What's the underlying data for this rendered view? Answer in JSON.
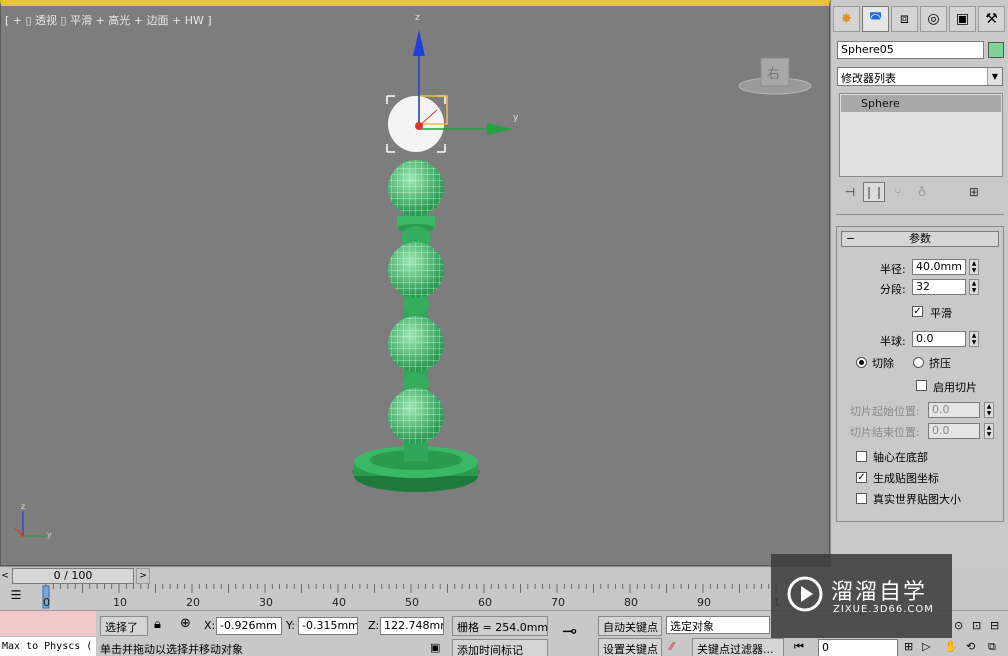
{
  "viewport": {
    "label": "[ + ▯ 透视 ▯ 平滑 + 高光 + 边面 + HW ]",
    "viewcube_label": "右",
    "accent_color": "#e8c14a",
    "object_color": "#3fbf6a",
    "axis_labels": {
      "z": "z",
      "y": "y",
      "x": "x"
    }
  },
  "command_panel": {
    "tabs": [
      "create-icon",
      "modify-icon",
      "hierarchy-icon",
      "motion-icon",
      "display-icon",
      "utilities-icon"
    ],
    "object_name": "Sphere05",
    "object_color": "#7fd39a",
    "modifier_list": "修改器列表",
    "stack_item": "Sphere",
    "params": {
      "title": "参数",
      "radius_label": "半径:",
      "radius_value": "40.0mm",
      "segments_label": "分段:",
      "segments_value": "32",
      "smooth_label": "平滑",
      "smooth_checked": true,
      "hemisphere_label": "半球:",
      "hemisphere_value": "0.0",
      "chop_label": "切除",
      "squash_label": "挤压",
      "enable_slice_label": "启用切片",
      "slice_from_label": "切片起始位置:",
      "slice_from_value": "0.0",
      "slice_to_label": "切片结束位置:",
      "slice_to_value": "0.0",
      "base_to_pivot_label": "轴心在底部",
      "gen_map_coords_label": "生成贴图坐标",
      "gen_map_coords_checked": true,
      "real_world_label": "真实世界贴图大小"
    }
  },
  "timeslider": {
    "left_arrow": "<",
    "position": "0 / 100",
    "right_arrow": ">"
  },
  "trackbar": {
    "ticks": [
      "0",
      "10",
      "20",
      "30",
      "40",
      "50",
      "60",
      "70",
      "80",
      "90",
      "1"
    ]
  },
  "status": {
    "maxscript_text": "Max to Physcs (",
    "selection_label": "选择了",
    "x_label": "X:",
    "x_value": "-0.926mm",
    "y_label": "Y:",
    "y_value": "-0.315mm",
    "z_label": "Z:",
    "z_value": "122.748mm",
    "grid_text": "栅格 = 254.0mm",
    "auto_key": "自动关键点",
    "set_key": "设置关键点",
    "selected_dropdown": "选定对象",
    "key_filters": "关键点过滤器...",
    "frame_value": "0",
    "prompt": "单击并拖动以选择并移动对象",
    "add_time_tag": "添加时间标记"
  },
  "watermark": {
    "title": "溜溜自学",
    "url": "ZIXUE.3D66.COM"
  }
}
